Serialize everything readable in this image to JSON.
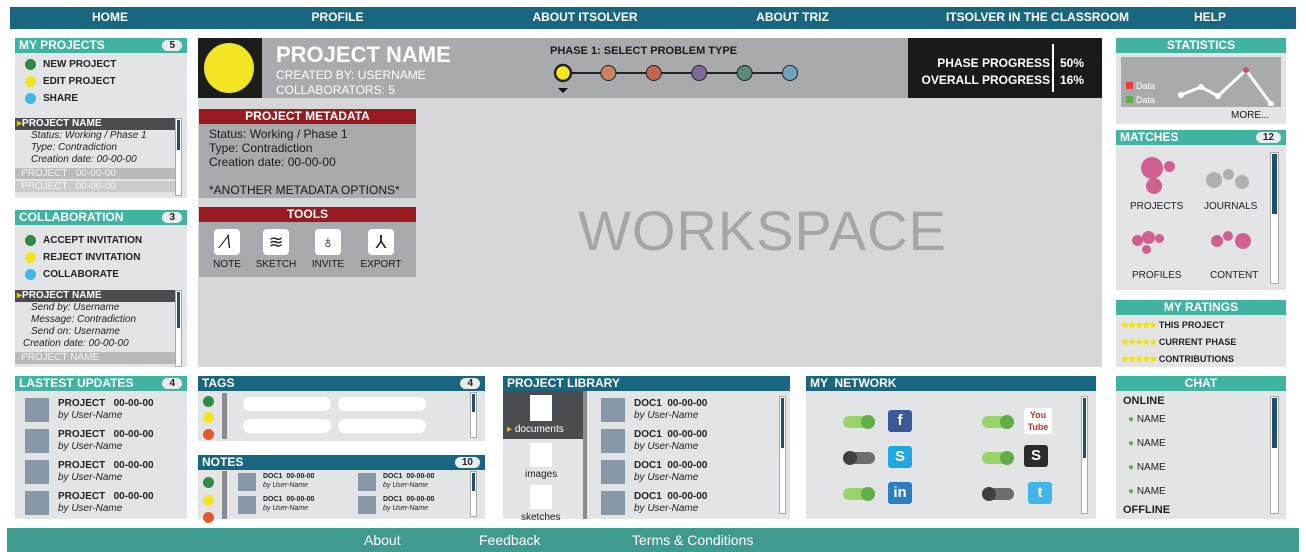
{
  "nav": [
    "HOME",
    "PROFILE",
    "ABOUT ITSOLVER",
    "ABOUT TRIZ",
    "ITSOLVER IN THE CLASSROOM",
    "HELP"
  ],
  "my_projects": {
    "title": "MY PROJECTS",
    "count": "5",
    "actions": [
      "NEW PROJECT",
      "EDIT PROJECT",
      "SHARE"
    ],
    "selected": {
      "name": "PROJECT NAME",
      "lines": [
        "Status: Working / Phase 1",
        "Type: Contradiction",
        "Creation date: 00-00-00"
      ]
    },
    "others": [
      "PROJECT   00-00-00",
      "PROJECT   00-00-00"
    ]
  },
  "collaboration": {
    "title": "COLLABORATION",
    "count": "3",
    "actions": [
      "ACCEPT INVITATION",
      "REJECT INVITATION",
      "COLLABORATE"
    ],
    "selected": {
      "name": "PROJECT NAME",
      "lines": [
        "Send by: Username",
        "Message: Contradiction",
        "Send on: Username",
        "Creation date: 00-00-00"
      ]
    },
    "other": "PROJECT NAME"
  },
  "header": {
    "project_name": "PROJECT NAME",
    "created_by": "CREATED BY: USERNAME",
    "collaborators": "COLLABORATORS: 5",
    "phase_title": "PHASE 1: SELECT PROBLEM TYPE",
    "phase_label": "PHASE PROGRESS",
    "phase_value": "50%",
    "overall_label": "OVERALL PROGRESS",
    "overall_value": "16%"
  },
  "phase_colors": [
    "#f2e522",
    "#c8855f",
    "#c0674e",
    "#7d6a9a",
    "#5a8a78",
    "#6ea6b8"
  ],
  "metadata": {
    "title": "PROJECT METADATA",
    "lines": [
      "Status: Working / Phase 1",
      "Type: Contradiction",
      "Creation date: 00-00-00"
    ],
    "more": "*ANOTHER METADATA OPTIONS*"
  },
  "tools": {
    "title": "TOOLS",
    "items": [
      "NOTE",
      "SKETCH",
      "INVITE",
      "EXPORT"
    ]
  },
  "workspace": "WORKSPACE",
  "statistics": {
    "title": "STATISTICS",
    "legend": [
      "Data",
      "Data"
    ],
    "more": "MORE..."
  },
  "matches": {
    "title": "MATCHES",
    "count": "12",
    "labels": [
      "PROJECTS",
      "JOURNALS",
      "PROFILES",
      "CONTENT"
    ]
  },
  "ratings": {
    "title": "MY RATINGS",
    "items": [
      "THIS PROJECT",
      "CURRENT PHASE",
      "CONTRIBUTIONS"
    ]
  },
  "updates": {
    "title": "LASTEST UPDATES",
    "count": "4",
    "items": [
      {
        "t": "PROJECT   00-00-00",
        "s": "by User-Name"
      },
      {
        "t": "PROJECT   00-00-00",
        "s": "by User-Name"
      },
      {
        "t": "PROJECT   00-00-00",
        "s": "by User-Name"
      },
      {
        "t": "PROJECT   00-00-00",
        "s": "by User-Name"
      }
    ]
  },
  "tags": {
    "title": "TAGS",
    "count": "4"
  },
  "notes": {
    "title": "NOTES",
    "count": "10",
    "items": [
      {
        "t": "DOC1  00-00-00",
        "s": "by User-Name"
      },
      {
        "t": "DOC1  00-00-00",
        "s": "by User-Name"
      },
      {
        "t": "DOC1  00-00-00",
        "s": "by User-Name"
      },
      {
        "t": "DOC1  00-00-00",
        "s": "by User-Name"
      }
    ]
  },
  "library": {
    "title": "PROJECT LIBRARY",
    "folders": [
      "documents",
      "images",
      "sketches"
    ],
    "items": [
      {
        "t": "DOC1  00-00-00",
        "s": "by User-Name"
      },
      {
        "t": "DOC1  00-00-00",
        "s": "by User-Name"
      },
      {
        "t": "DOC1  00-00-00",
        "s": "by User-Name"
      },
      {
        "t": "DOC1  00-00-00",
        "s": "by User-Name"
      }
    ]
  },
  "network": {
    "title": "MY  NETWORK",
    "services": [
      "facebook-icon",
      "youtube-icon",
      "skype-icon",
      "scribd-icon",
      "linkedin-icon",
      "twitter-icon"
    ],
    "youtube_text": "You Tube"
  },
  "chat": {
    "title": "CHAT",
    "online": "ONLINE",
    "names": [
      "NAME",
      "NAME",
      "NAME",
      "NAME"
    ],
    "offline": "OFFLINE"
  },
  "footer": [
    "About",
    "Feedback",
    "Terms & Conditions"
  ]
}
